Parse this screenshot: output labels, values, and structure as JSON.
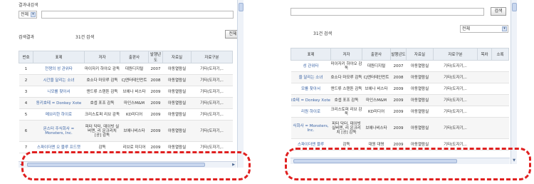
{
  "left": {
    "title": "결과내검색",
    "scope_select": "전체",
    "result_label": "검색결과",
    "result_count": "31건 검색",
    "view_button": "전체",
    "columns": [
      "번호",
      "표제",
      "저자",
      "출판사",
      "발행년도",
      "자료실",
      "자료구분"
    ],
    "rows": [
      [
        "1",
        "전쟁의 성 관위타",
        "마이자키 하야오 감독",
        "대원디지털",
        "2007",
        "아동열람실",
        "기타(도자기,.."
      ],
      [
        "2",
        "시간을 달리는 소녀",
        "호소다 마모루 감독",
        "CJ엔터테인먼트",
        "2008",
        "아동열람실",
        "기타(도자기,.."
      ],
      [
        "3",
        "니모를 찾아서",
        "앤드류 스탠튼 감독",
        "브에나 비스타",
        "2009",
        "아동열람실",
        "기타(도자기,.."
      ],
      [
        "4",
        "동키호테 = Donkey Xote",
        "호셉 포조 감독",
        "마인스M&M",
        "2009",
        "아동열람실",
        "기타(도자기,.."
      ],
      [
        "5",
        "메브리한 하이로",
        "크리스토퍼 리브 감독",
        "KD미디어",
        "2009",
        "아동열람실",
        "기타(도자기,.."
      ],
      [
        "6",
        "몬스터 주식회사 = Monsters, Inc.",
        "피터 닥터, 데이빗 실버맨, 리 운크리치 [공] 감독",
        "브에나비스타",
        "2009",
        "아동열람실",
        "기타(도자기,.."
      ],
      [
        "7",
        "스파이더맨 오 블루 프드캣",
        "감독",
        "리브로 미디어",
        "2009",
        "아동열람실",
        "기타(도자기,.."
      ]
    ]
  },
  "right": {
    "search_button": "검색",
    "scope_select": "전체",
    "result_count": "31건 검색",
    "columns": [
      "표제",
      "저자",
      "출판사",
      "발행년도",
      "자료실",
      "자료구분",
      "목차",
      "소록"
    ],
    "rows": [
      [
        "성 관위타",
        "미이자키 하야오 감독",
        "대원디지털",
        "2007",
        "아동열람실",
        "기타(도자기,.."
      ],
      [
        "을 달리는 소녀",
        "호소다 마모루 감독",
        "CJ엔터테인먼트",
        "2008",
        "아동열람실",
        "기타(도자기,.."
      ],
      [
        "모를 찾아서",
        "앤드류 스탠튼 감독",
        "브에나 비스타",
        "2009",
        "아동열람실",
        "기타(도자기,.."
      ],
      [
        "I호테 = Donkey Xote",
        "호셉 포조 감독",
        "마인스M&M",
        "2009",
        "아동열람실",
        "기타(도자기,.."
      ],
      [
        "리원 하이로",
        "크리스토퍼 리브 감독",
        "KD미디어",
        "2009",
        "아동열람실",
        "기타(도자기,.."
      ],
      [
        "식회사 = Monsters, Inc.",
        "피터 닥터, 데이빗 실버맨, 리 운크리치 [공] 감독",
        "브에나비스타",
        "2009",
        "아동열람실",
        "기타(도자기,.."
      ],
      [
        "스파이더맨 블루",
        "감독",
        "대원 대명",
        "2009",
        "아동열람실",
        "기타(도자기,.."
      ]
    ]
  },
  "colors": {
    "highlight": "#e02020",
    "title_link": "#3a63a5",
    "header_bg": "#e9eef4"
  }
}
